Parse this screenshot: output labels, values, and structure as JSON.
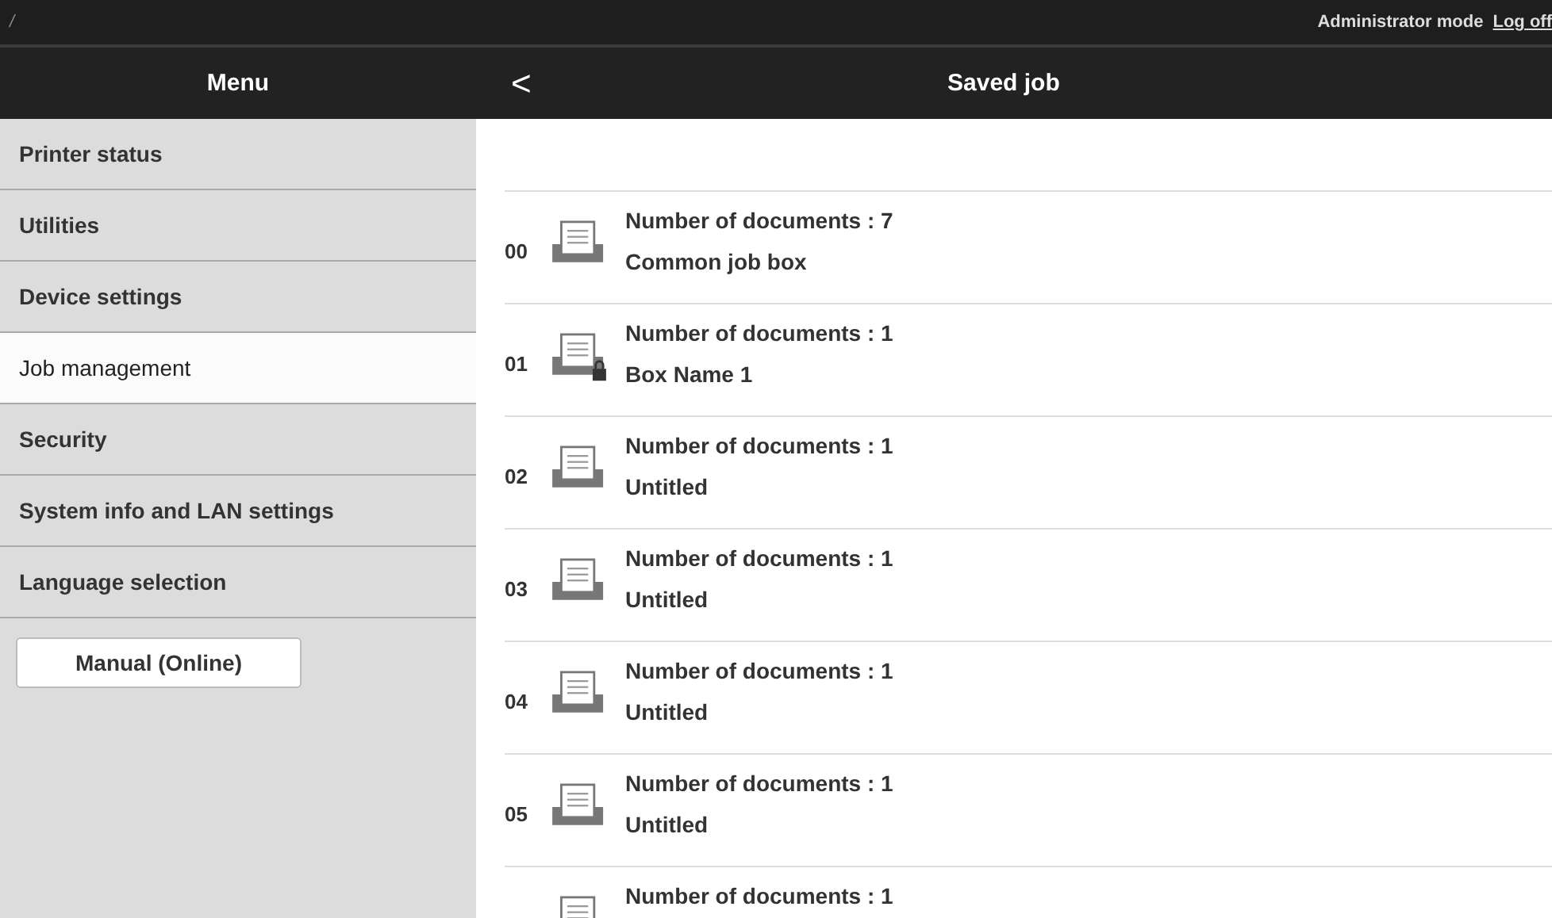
{
  "top_bar": {
    "path": "/",
    "mode": "Administrator mode",
    "logoff_link": "Log off"
  },
  "header": {
    "menu_title": "Menu",
    "back": "<",
    "page_title": "Saved job"
  },
  "sidebar": {
    "items": [
      {
        "label": "Printer status",
        "selected": false
      },
      {
        "label": "Utilities",
        "selected": false
      },
      {
        "label": "Device settings",
        "selected": false
      },
      {
        "label": "Job management",
        "selected": true
      },
      {
        "label": "Security",
        "selected": false
      },
      {
        "label": "System info and LAN settings",
        "selected": false
      },
      {
        "label": "Language selection",
        "selected": false
      }
    ],
    "manual_button": "Manual (Online)"
  },
  "boxes": [
    {
      "number": "00",
      "documents": "Number of documents : 7",
      "name": "Common job box",
      "locked": false
    },
    {
      "number": "01",
      "documents": "Number of documents : 1",
      "name": "Box Name 1",
      "locked": true
    },
    {
      "number": "02",
      "documents": "Number of documents : 1",
      "name": "Untitled",
      "locked": false
    },
    {
      "number": "03",
      "documents": "Number of documents : 1",
      "name": "Untitled",
      "locked": false
    },
    {
      "number": "04",
      "documents": "Number of documents : 1",
      "name": "Untitled",
      "locked": false
    },
    {
      "number": "05",
      "documents": "Number of documents : 1",
      "name": "Untitled",
      "locked": false
    },
    {
      "documents": "Number of documents : 1"
    }
  ]
}
